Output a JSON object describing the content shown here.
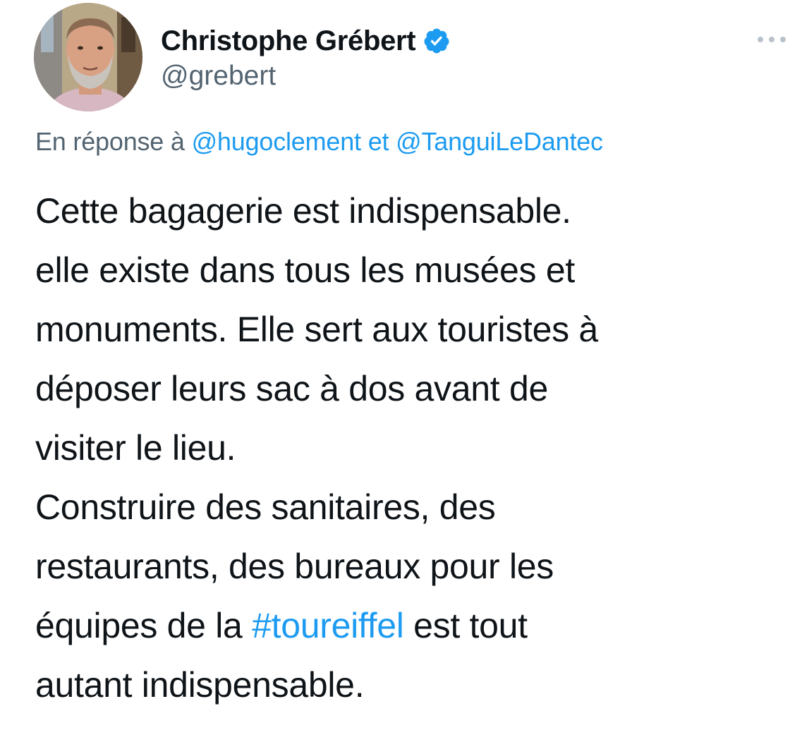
{
  "author": {
    "display_name": "Christophe Grébert",
    "handle": "@grebert",
    "verified": true
  },
  "reply_context": {
    "prefix": "En réponse à",
    "mention_1": "@hugoclement",
    "conjunction": "et",
    "mention_2": "@TanguiLeDantec"
  },
  "tweet": {
    "lines": [
      "Cette bagagerie est indispensable.",
      "elle existe dans tous les musées et",
      "monuments. Elle sert aux touristes à",
      "déposer leurs sac à dos avant de",
      "visiter le lieu.",
      "Construire des sanitaires, des",
      "restaurants, des bureaux pour les"
    ],
    "line_8_before": "équipes de la",
    "hashtag": "#toureiffel",
    "line_8_after": "est tout",
    "line_9": "autant indispensable."
  },
  "icons": {
    "verified": "verified-badge-icon",
    "more": "more-options-icon"
  },
  "colors": {
    "accent": "#1d9bf0",
    "text_primary": "#0f1419",
    "text_secondary": "#536471",
    "more_icon": "#b9c2ca"
  }
}
